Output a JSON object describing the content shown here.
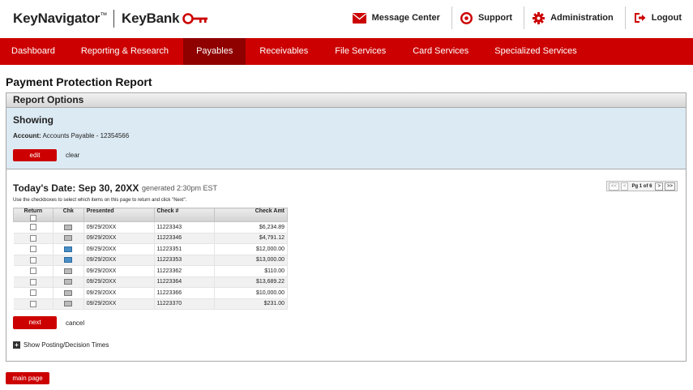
{
  "brand": {
    "product": "KeyNavigator",
    "product_tm": "™",
    "bank": "KeyBank"
  },
  "utility": {
    "message_center": "Message Center",
    "support": "Support",
    "administration": "Administration",
    "logout": "Logout"
  },
  "nav": {
    "items": [
      "Dashboard",
      "Reporting & Research",
      "Payables",
      "Receivables",
      "File Services",
      "Card Services",
      "Specialized Services"
    ],
    "active": "Payables"
  },
  "page_title": "Payment Protection Report",
  "report_options": {
    "heading": "Report Options",
    "showing_title": "Showing",
    "account_label": "Account:",
    "account_value": "Accounts Payable - 12354566",
    "edit_label": "edit",
    "clear_label": "clear"
  },
  "report": {
    "today_label": "Today's Date:",
    "today_value": "Sep 30, 20XX",
    "generated": "generated 2:30pm EST",
    "instructions": "Use the checkboxes to select which items on this page to return and click \"Next\".",
    "pager": {
      "first": "<<",
      "prev": "<",
      "label": "Pg 1 of 6",
      "next": ">",
      "last": ">>"
    },
    "columns": {
      "return": "Return",
      "chk": "Chk",
      "presented": "Presented",
      "check_no": "Check #",
      "check_amt": "Check Amt"
    },
    "rows": [
      {
        "presented": "09/29/20XX",
        "check_no": "11223343",
        "amount": "$6,234.89",
        "chk_icon": "check-image-icon"
      },
      {
        "presented": "09/29/20XX",
        "check_no": "11223346",
        "amount": "$4,791.12",
        "chk_icon": "check-image-icon"
      },
      {
        "presented": "09/29/20XX",
        "check_no": "11223351",
        "amount": "$12,000.00",
        "chk_icon": "check-image-blue-icon"
      },
      {
        "presented": "09/29/20XX",
        "check_no": "11223353",
        "amount": "$13,000.00",
        "chk_icon": "check-image-blue-icon"
      },
      {
        "presented": "09/29/20XX",
        "check_no": "11223362",
        "amount": "$110.00",
        "chk_icon": "check-image-icon"
      },
      {
        "presented": "09/29/20XX",
        "check_no": "11223364",
        "amount": "$13,689.22",
        "chk_icon": "check-image-icon"
      },
      {
        "presented": "09/29/20XX",
        "check_no": "11223366",
        "amount": "$10,000.00",
        "chk_icon": "check-image-icon"
      },
      {
        "presented": "09/29/20XX",
        "check_no": "11223370",
        "amount": "$231.00",
        "chk_icon": "check-image-icon"
      }
    ],
    "next_label": "next",
    "cancel_label": "cancel",
    "show_times_label": "Show Posting/Decision Times"
  },
  "main_page_label": "main page",
  "colors": {
    "brand_red": "#cc0000",
    "nav_active": "#8f0000",
    "showing_bg": "#dceaf3"
  }
}
